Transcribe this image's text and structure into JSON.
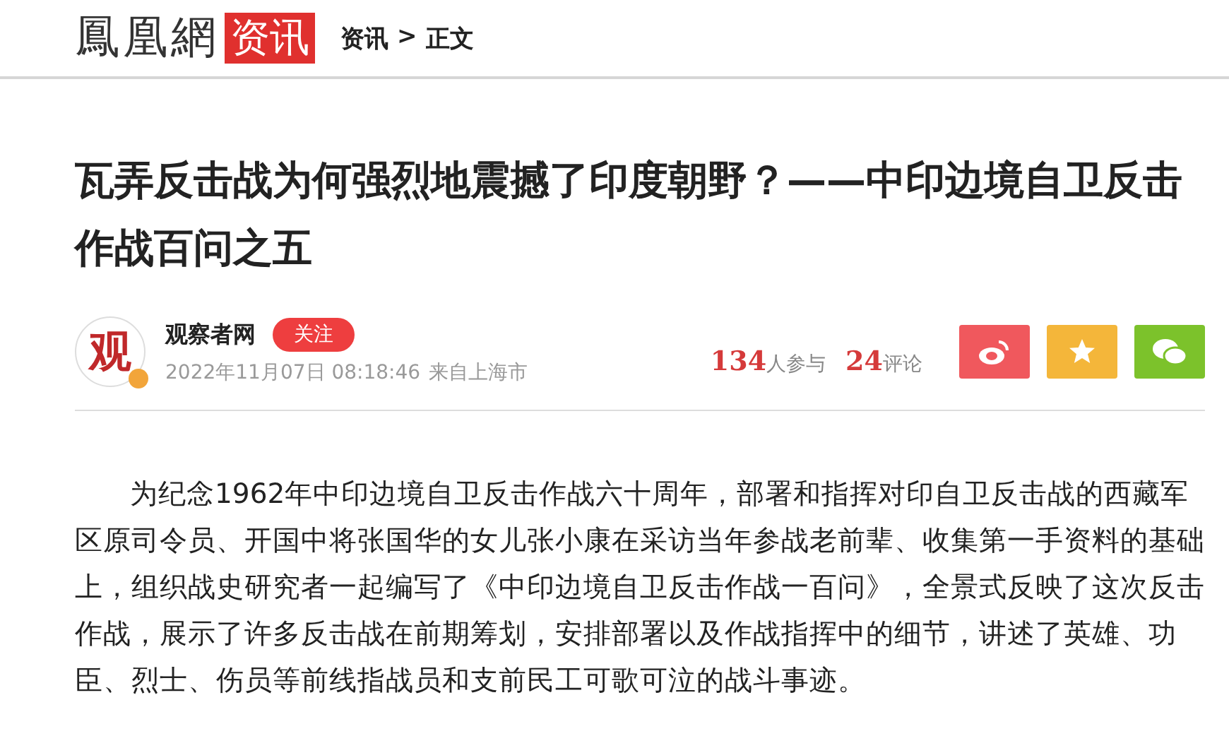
{
  "header": {
    "logo": "鳳凰網",
    "channel": "资讯",
    "breadcrumb": [
      "资讯",
      "正文"
    ],
    "separator": ">"
  },
  "article": {
    "title": "瓦弄反击战为何强烈地震撼了印度朝野？——中印边境自卫反击作战百问之五",
    "author": {
      "avatar_text": "观",
      "verified": true,
      "name": "观察者网",
      "follow": "关注",
      "datetime": "2022年11月07日 08:18:46",
      "source": "来自上海市"
    },
    "stats": [
      {
        "count": "134",
        "label": "人参与"
      },
      {
        "count": "24",
        "label": "评论"
      }
    ],
    "share": [
      {
        "kind": "weibo"
      },
      {
        "kind": "favorite"
      },
      {
        "kind": "wechat"
      }
    ],
    "paragraphs": [
      "为纪念1962年中印边境自卫反击作战六十周年，部署和指挥对印自卫反击战的西藏军区原司令员、开国中将张国华的女儿张小康在采访当年参战老前辈、收集第一手资料的基础上，组织战史研究者一起编写了《中印边境自卫反击作战一百问》，全景式反映了这次反击作战，展示了许多反击战在前期筹划，安排部署以及作战指挥中的细节，讲述了英雄、功臣、烈士、伤员等前线指战员和支前民工可歌可泣的战斗事迹。"
    ]
  }
}
